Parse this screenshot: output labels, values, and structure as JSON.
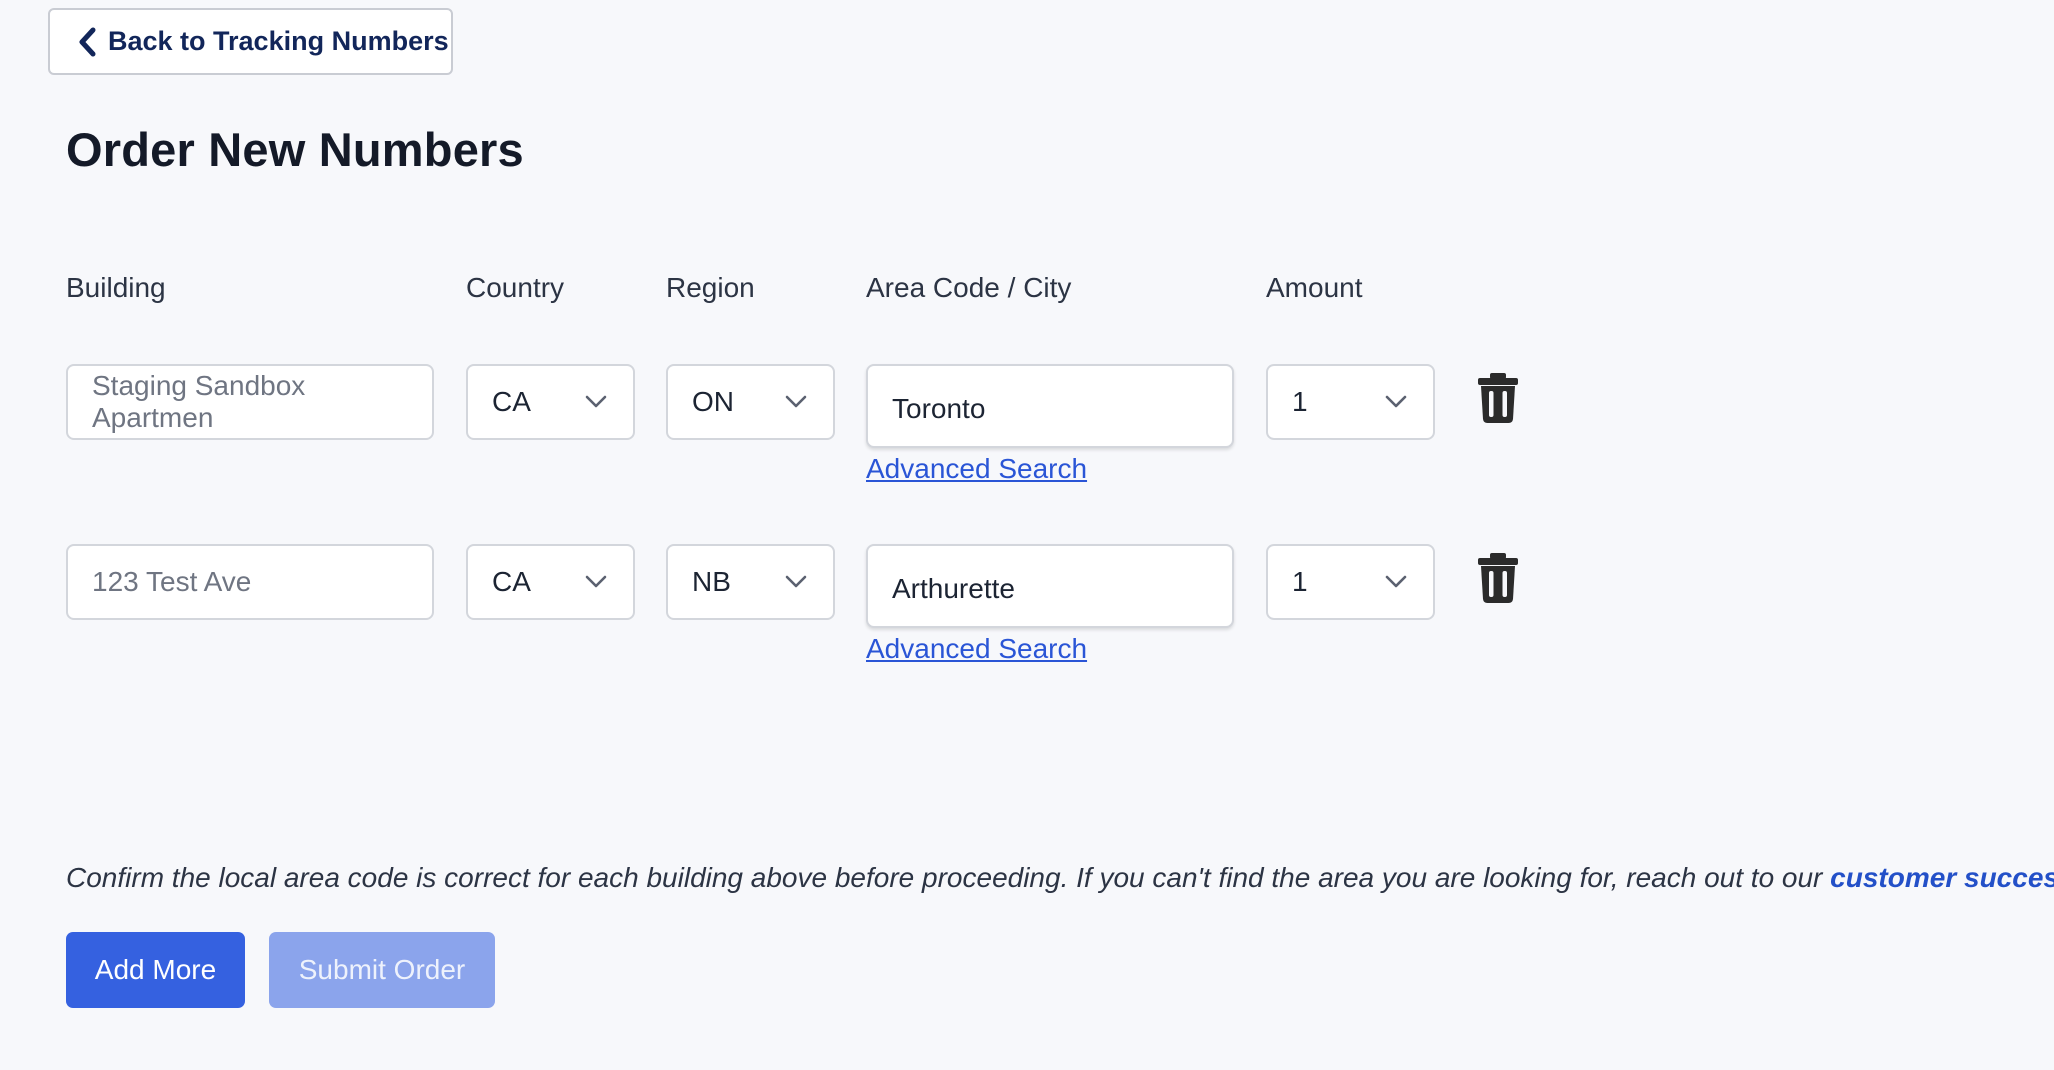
{
  "back_button": {
    "label": "Back to Tracking Numbers",
    "icon": "chevron-left-icon"
  },
  "page_title": "Order New Numbers",
  "columns": {
    "building": "Building",
    "country": "Country",
    "region": "Region",
    "area_code_city": "Area Code / City",
    "amount": "Amount"
  },
  "rows": [
    {
      "building_placeholder": "Staging Sandbox Apartmen",
      "country": "CA",
      "region": "ON",
      "city": "Toronto",
      "advanced_search": "Advanced Search",
      "amount": "1",
      "delete_icon": "trash-icon"
    },
    {
      "building_placeholder": "123 Test Ave",
      "country": "CA",
      "region": "NB",
      "city": "Arthurette",
      "advanced_search": "Advanced Search",
      "amount": "1",
      "delete_icon": "trash-icon"
    }
  ],
  "notice": {
    "text": "Confirm the local area code is correct for each building above before proceeding. If you can't find the area you are looking for, reach out to our ",
    "link": "customer success team",
    "end": "."
  },
  "actions": {
    "add_more": "Add More",
    "submit_order": "Submit Order"
  },
  "colors": {
    "primary": "#3561e0",
    "primary_disabled": "#8ba4ec",
    "link": "#2a55d6",
    "heading": "#141a28",
    "back_text": "#12265a",
    "background": "#f7f8fb"
  }
}
